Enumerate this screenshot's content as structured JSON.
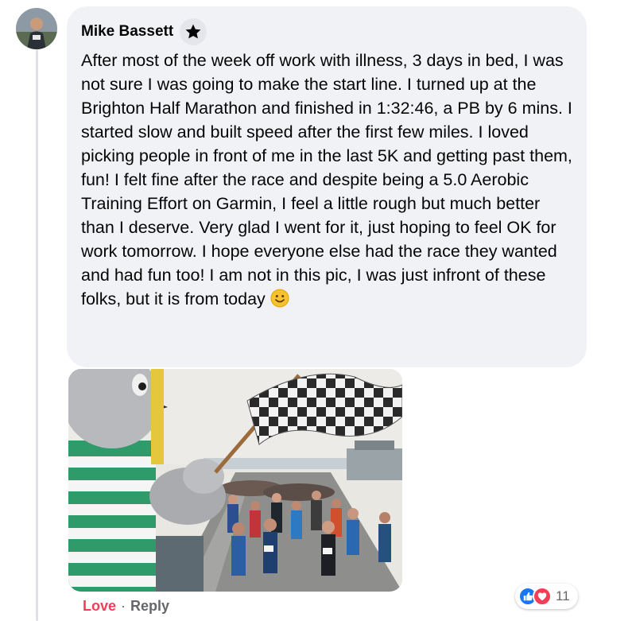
{
  "comment": {
    "author": "Mike Bassett",
    "text": "After most of the week off work with illness, 3 days in bed, I was not sure I was going to make the start line. I turned up at the Brighton Half Marathon and finished in 1:32:46, a PB by 6 mins. I started slow and built speed after the first few miles. I loved picking people in front of me in the last 5K and getting past them, fun! I felt fine after the race and despite being a 5.0 Aerobic Training Effort on Garmin, I feel a little rough but much better than I deserve. Very glad I went for it, just hoping to feel OK for work tomorrow. I hope everyone else had the race they wanted and had fun too! I am not in this pic, I was just infront of these folks, but it is from today "
  },
  "actions": {
    "love": "Love",
    "separator": "·",
    "reply": "Reply"
  },
  "reactions": {
    "count": "11",
    "icons": [
      "like-icon",
      "love-icon"
    ]
  },
  "colors": {
    "bubble": "#f0f2f5",
    "love_text": "#f33e58",
    "like_blue": "#1877f2",
    "meta_gray": "#65676b"
  }
}
